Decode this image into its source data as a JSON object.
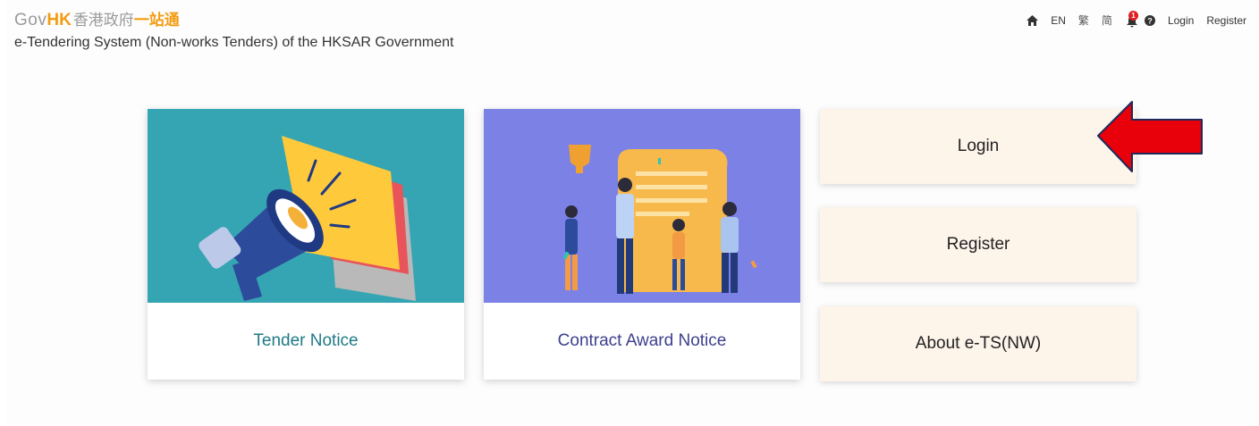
{
  "header": {
    "brand_gov": "Gov",
    "brand_hk": "HK",
    "brand_cn": "香港政府",
    "brand_cn2": "一站通",
    "system_title": "e-Tendering System (Non-works Tenders) of the HKSAR Government"
  },
  "topnav": {
    "lang_en": "EN",
    "lang_tc": "繁",
    "lang_sc": "简",
    "notification_count": "1",
    "login": "Login",
    "register": "Register"
  },
  "cards": {
    "tender_notice": "Tender Notice",
    "contract_award_notice": "Contract Award Notice"
  },
  "actions": {
    "login": "Login",
    "register": "Register",
    "about": "About e-TS(NW)"
  },
  "colors": {
    "brand_orange": "#f39c12",
    "tender_bg": "#35a5b3",
    "award_bg": "#7c81e5",
    "action_bg": "#fdf4ea",
    "arrow_red": "#e8000a"
  },
  "icons": [
    "home-icon",
    "bell-icon",
    "help-icon",
    "megaphone-illustration",
    "trophy-celebration-illustration",
    "red-arrow-annotation"
  ]
}
